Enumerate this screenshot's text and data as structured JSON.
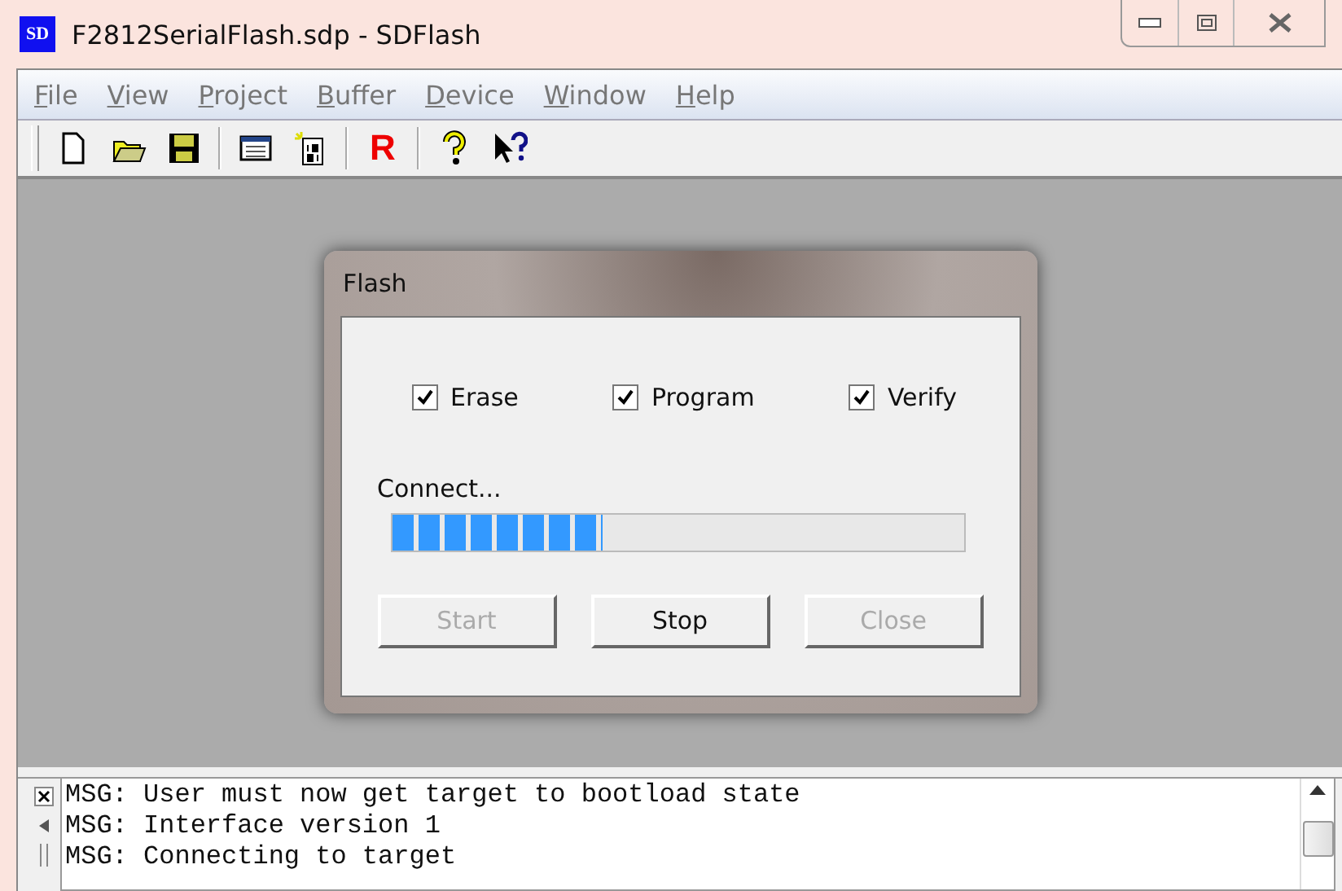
{
  "window": {
    "title": "F2812SerialFlash.sdp - SDFlash",
    "logo": "SD"
  },
  "menu": [
    {
      "label": "File"
    },
    {
      "label": "View"
    },
    {
      "label": "Project"
    },
    {
      "label": "Buffer"
    },
    {
      "label": "Device"
    },
    {
      "label": "Window"
    },
    {
      "label": "Help"
    }
  ],
  "toolbar": [
    {
      "kind": "new"
    },
    {
      "kind": "open"
    },
    {
      "kind": "save"
    },
    {
      "kind": "separator"
    },
    {
      "kind": "list"
    },
    {
      "kind": "binary"
    },
    {
      "kind": "separator"
    },
    {
      "kind": "letter",
      "label": "R"
    },
    {
      "kind": "separator"
    },
    {
      "kind": "help"
    },
    {
      "kind": "context-help"
    }
  ],
  "dialog": {
    "title": "Flash",
    "options": [
      {
        "label": "Erase",
        "checked": true
      },
      {
        "label": "Program",
        "checked": true
      },
      {
        "label": "Verify",
        "checked": true
      }
    ],
    "status": "Connect...",
    "progress": {
      "level": 0.37
    },
    "buttons": [
      {
        "label": "Start",
        "disabled": true
      },
      {
        "label": "Stop",
        "disabled": false
      },
      {
        "label": "Close",
        "disabled": true
      }
    ]
  },
  "log": {
    "lines": [
      "MSG: User must now get target to bootload state",
      "MSG: Interface version 1",
      "MSG: Connecting to target"
    ]
  }
}
